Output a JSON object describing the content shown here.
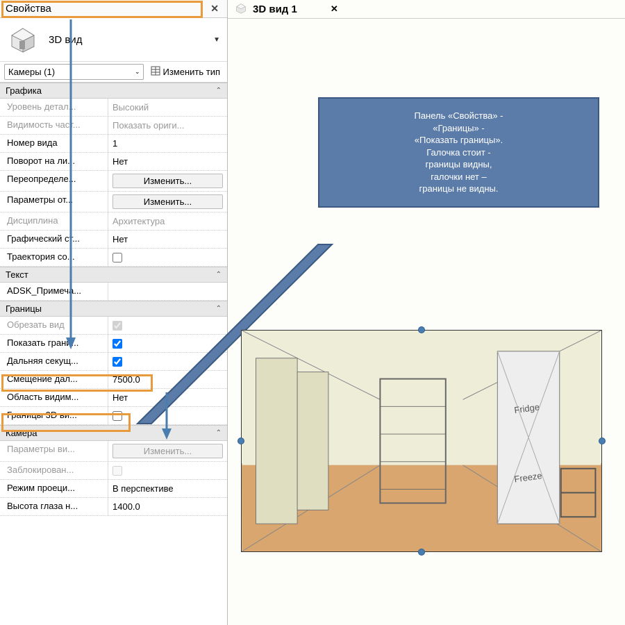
{
  "panel": {
    "title": "Свойства",
    "type_selector": {
      "label": "3D вид"
    },
    "instance": {
      "combo": "Камеры (1)",
      "edit_type": "Изменить тип"
    }
  },
  "groups": {
    "graphics": {
      "title": "Графика",
      "rows": {
        "detail": {
          "label": "Уровень детал...",
          "value": "Высокий"
        },
        "visibility": {
          "label": "Видимость част...",
          "value": "Показать ориги..."
        },
        "viewnum": {
          "label": "Номер вида",
          "value": "1"
        },
        "rotate": {
          "label": "Поворот на ли...",
          "value": "Нет"
        },
        "override": {
          "label": "Переопределе...",
          "button": "Изменить..."
        },
        "params": {
          "label": "Параметры от...",
          "button": "Изменить..."
        },
        "discipline": {
          "label": "Дисциплина",
          "value": "Архитектура"
        },
        "gstyle": {
          "label": "Графический ст...",
          "value": "Нет"
        },
        "trajectory": {
          "label": "Траектория со..."
        }
      }
    },
    "text": {
      "title": "Текст",
      "rows": {
        "adsk": {
          "label": "ADSK_Примеча..."
        }
      }
    },
    "bounds": {
      "title": "Границы",
      "rows": {
        "crop": {
          "label": "Обрезать вид"
        },
        "showcrop": {
          "label": "Показать грани..."
        },
        "farclip": {
          "label": "Дальняя секущ..."
        },
        "faroffset": {
          "label": "Смещение дал...",
          "value": "7500.0"
        },
        "visreg": {
          "label": "Область видим...",
          "value": "Нет"
        },
        "bounds3d": {
          "label": "Границы 3D ви..."
        }
      }
    },
    "camera": {
      "title": "Камера",
      "rows": {
        "viewparams": {
          "label": "Параметры ви...",
          "button": "Изменить..."
        },
        "locked": {
          "label": "Заблокирован..."
        },
        "projection": {
          "label": "Режим проеци...",
          "value": "В перспективе"
        },
        "eyeh": {
          "label": "Высота глаза н...",
          "value": "1400.0"
        }
      }
    }
  },
  "view_tab": {
    "title": "3D вид 1"
  },
  "callout": {
    "line1": "Панель «Свойства» -",
    "line2": "«Границы» -",
    "line3": "«Показать границы».",
    "line4": "Галочка стоит -",
    "line5": "границы видны,",
    "line6": "галочки нет –",
    "line7": "границы не видны."
  }
}
